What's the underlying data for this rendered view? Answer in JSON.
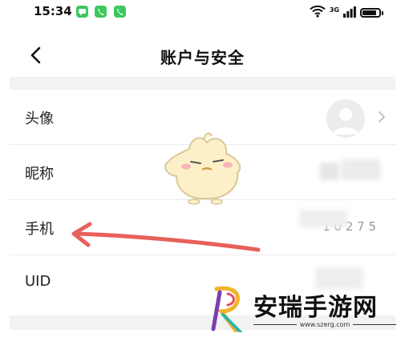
{
  "status_bar": {
    "time": "15:34",
    "network": "3G",
    "battery_level": 0.85,
    "notification_color": "#3cc85d"
  },
  "nav": {
    "title": "账户与安全",
    "back_icon": "chevron-left-icon"
  },
  "settings": {
    "items": [
      {
        "label": "头像",
        "value": ""
      },
      {
        "label": "昵称",
        "value": ""
      },
      {
        "label": "手机",
        "value": "1 0    2 7 5"
      },
      {
        "label": "UID",
        "value": ""
      }
    ]
  },
  "annotation": {
    "arrow_color": "#e8605a"
  },
  "watermark": {
    "title": "安瑞手游网",
    "url": "www.szerg.com"
  }
}
